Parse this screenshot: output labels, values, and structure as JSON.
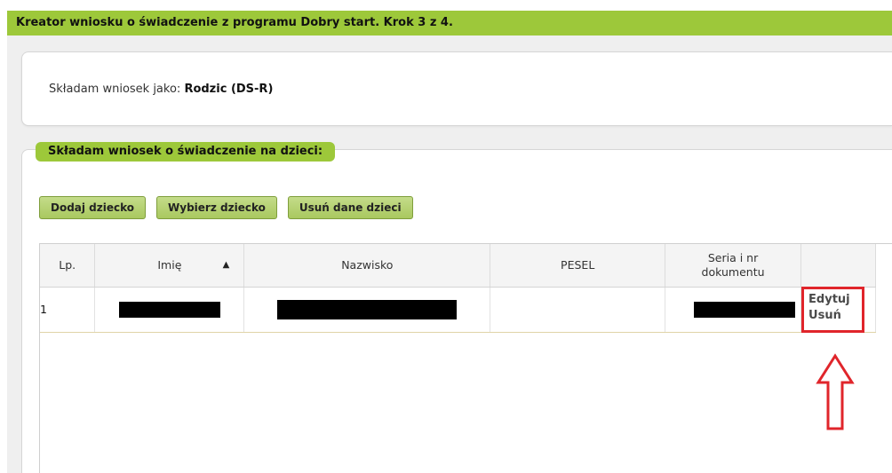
{
  "title_bar": {
    "text": "Kreator wniosku o świadczenie z programu Dobry start. Krok 3 z 4."
  },
  "applicant": {
    "prefix": "Składam wniosek jako: ",
    "value": "Rodzic (DS-R)"
  },
  "children_section": {
    "label": "Składam wniosek o świadczenie na dzieci:",
    "buttons": {
      "add": "Dodaj dziecko",
      "choose": "Wybierz dziecko",
      "remove_all": "Usuń dane dzieci"
    },
    "table": {
      "headers": {
        "lp": "Lp.",
        "imie": "Imię",
        "nazwisko": "Nazwisko",
        "pesel": "PESEL",
        "seria_nr": "Seria i nr dokumentu"
      },
      "sort": {
        "column": "imie",
        "direction": "ascending",
        "icon": "sort-up-icon"
      },
      "rows": [
        {
          "lp": "1",
          "imie": "[redacted]",
          "nazwisko": "[redacted]",
          "pesel": "",
          "seria_nr": "[redacted]",
          "actions": {
            "edit": "Edytuj",
            "remove": "Usuń"
          }
        }
      ]
    }
  },
  "annotation": {
    "highlight_color": "#e0252b",
    "arrow_icon": "outline-up-arrow-icon"
  },
  "colors": {
    "accent_green": "#9dc83a",
    "button_green": "#b5d26f",
    "panel_background": "#efefef"
  }
}
